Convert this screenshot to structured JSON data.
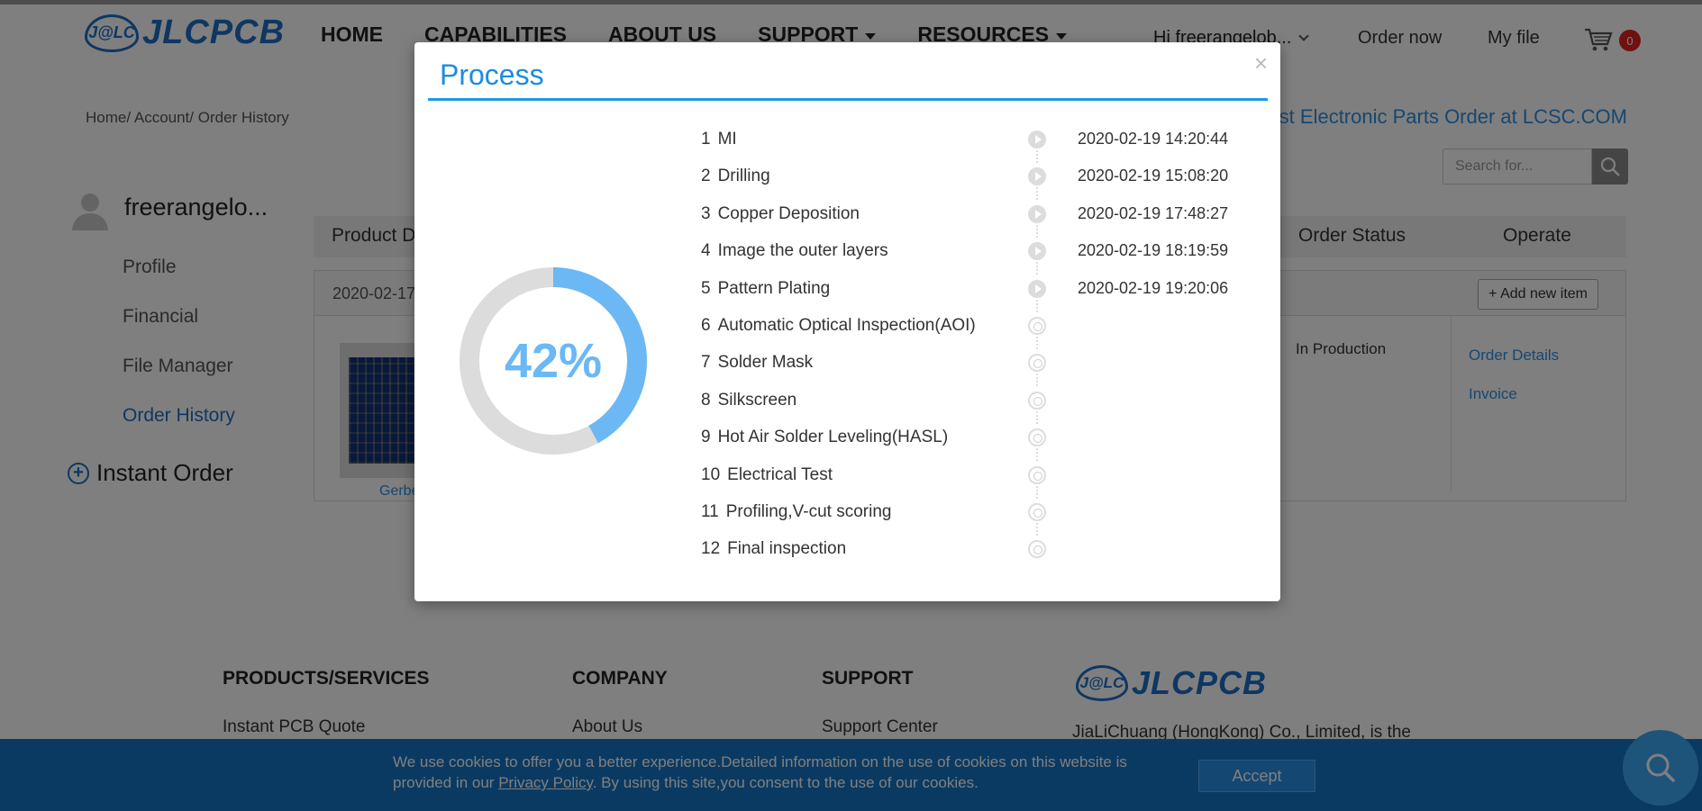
{
  "header": {
    "logo_badge": "J@LC",
    "logo_text": "JLCPCB",
    "nav": [
      "HOME",
      "CAPABILITIES",
      "ABOUT US",
      "SUPPORT",
      "RESOURCES"
    ],
    "user_greeting": "Hi freerangelob...",
    "order_now": "Order now",
    "my_file": "My file",
    "cart_count": "0"
  },
  "breadcrumb": "Home/  Account/  Order History",
  "lcsc_link": "st Electronic Parts Order at LCSC.COM",
  "search": {
    "placeholder": "Search for..."
  },
  "sidebar": {
    "username": "freerangelo...",
    "items": [
      {
        "label": "Profile"
      },
      {
        "label": "Financial"
      },
      {
        "label": "File Manager"
      },
      {
        "label": "Order History"
      }
    ],
    "instant_order": "Instant Order"
  },
  "table": {
    "columns": [
      "Product D",
      "Order Status",
      "Operate"
    ],
    "order_date": "2020-02-17",
    "add_item": "+ Add new item",
    "gerber_link": "Gerbe",
    "status": "In Production",
    "operate_links": [
      "Order Details",
      "Invoice"
    ]
  },
  "footer": {
    "headings": [
      "PRODUCTS/SERVICES",
      "COMPANY",
      "SUPPORT"
    ],
    "links": [
      "Instant PCB Quote",
      "About Us",
      "Support Center"
    ],
    "desc": "JiaLiChuang (HongKong) Co., Limited, is the"
  },
  "cookie": {
    "text_before": "We use cookies to offer you a better experience.Detailed information on the use of cookies on this website is provided in our ",
    "link": "Privacy Policy",
    "text_after": ". By using this site,you consent to the use of our cookies.",
    "accept": "Accept"
  },
  "modal": {
    "title": "Process",
    "close": "×",
    "progress_percent": 42,
    "progress_label": "42%",
    "steps": [
      {
        "num": "1",
        "name": "MI",
        "time": "2020-02-19 14:20:44",
        "done": true
      },
      {
        "num": "2",
        "name": "Drilling",
        "time": "2020-02-19 15:08:20",
        "done": true
      },
      {
        "num": "3",
        "name": "Copper Deposition",
        "time": "2020-02-19 17:48:27",
        "done": true
      },
      {
        "num": "4",
        "name": "Image the outer layers",
        "time": "2020-02-19 18:19:59",
        "done": true
      },
      {
        "num": "5",
        "name": "Pattern Plating",
        "time": "2020-02-19 19:20:06",
        "done": true
      },
      {
        "num": "6",
        "name": "Automatic Optical Inspection(AOI)",
        "time": "",
        "done": false
      },
      {
        "num": "7",
        "name": "Solder Mask",
        "time": "",
        "done": false
      },
      {
        "num": "8",
        "name": "Silkscreen",
        "time": "",
        "done": false
      },
      {
        "num": "9",
        "name": "Hot Air Solder Leveling(HASL)",
        "time": "",
        "done": false
      },
      {
        "num": "10",
        "name": "Electrical Test",
        "time": "",
        "done": false
      },
      {
        "num": "11",
        "name": "Profiling,V-cut scoring",
        "time": "",
        "done": false
      },
      {
        "num": "12",
        "name": "Final inspection",
        "time": "",
        "done": false
      }
    ]
  },
  "colors": {
    "brand": "#1d6fc4",
    "accent": "#2196e8",
    "ring_progress": "#6bb8f5",
    "ring_track": "#dcdcdc",
    "cookie_bar": "#1474c4"
  }
}
